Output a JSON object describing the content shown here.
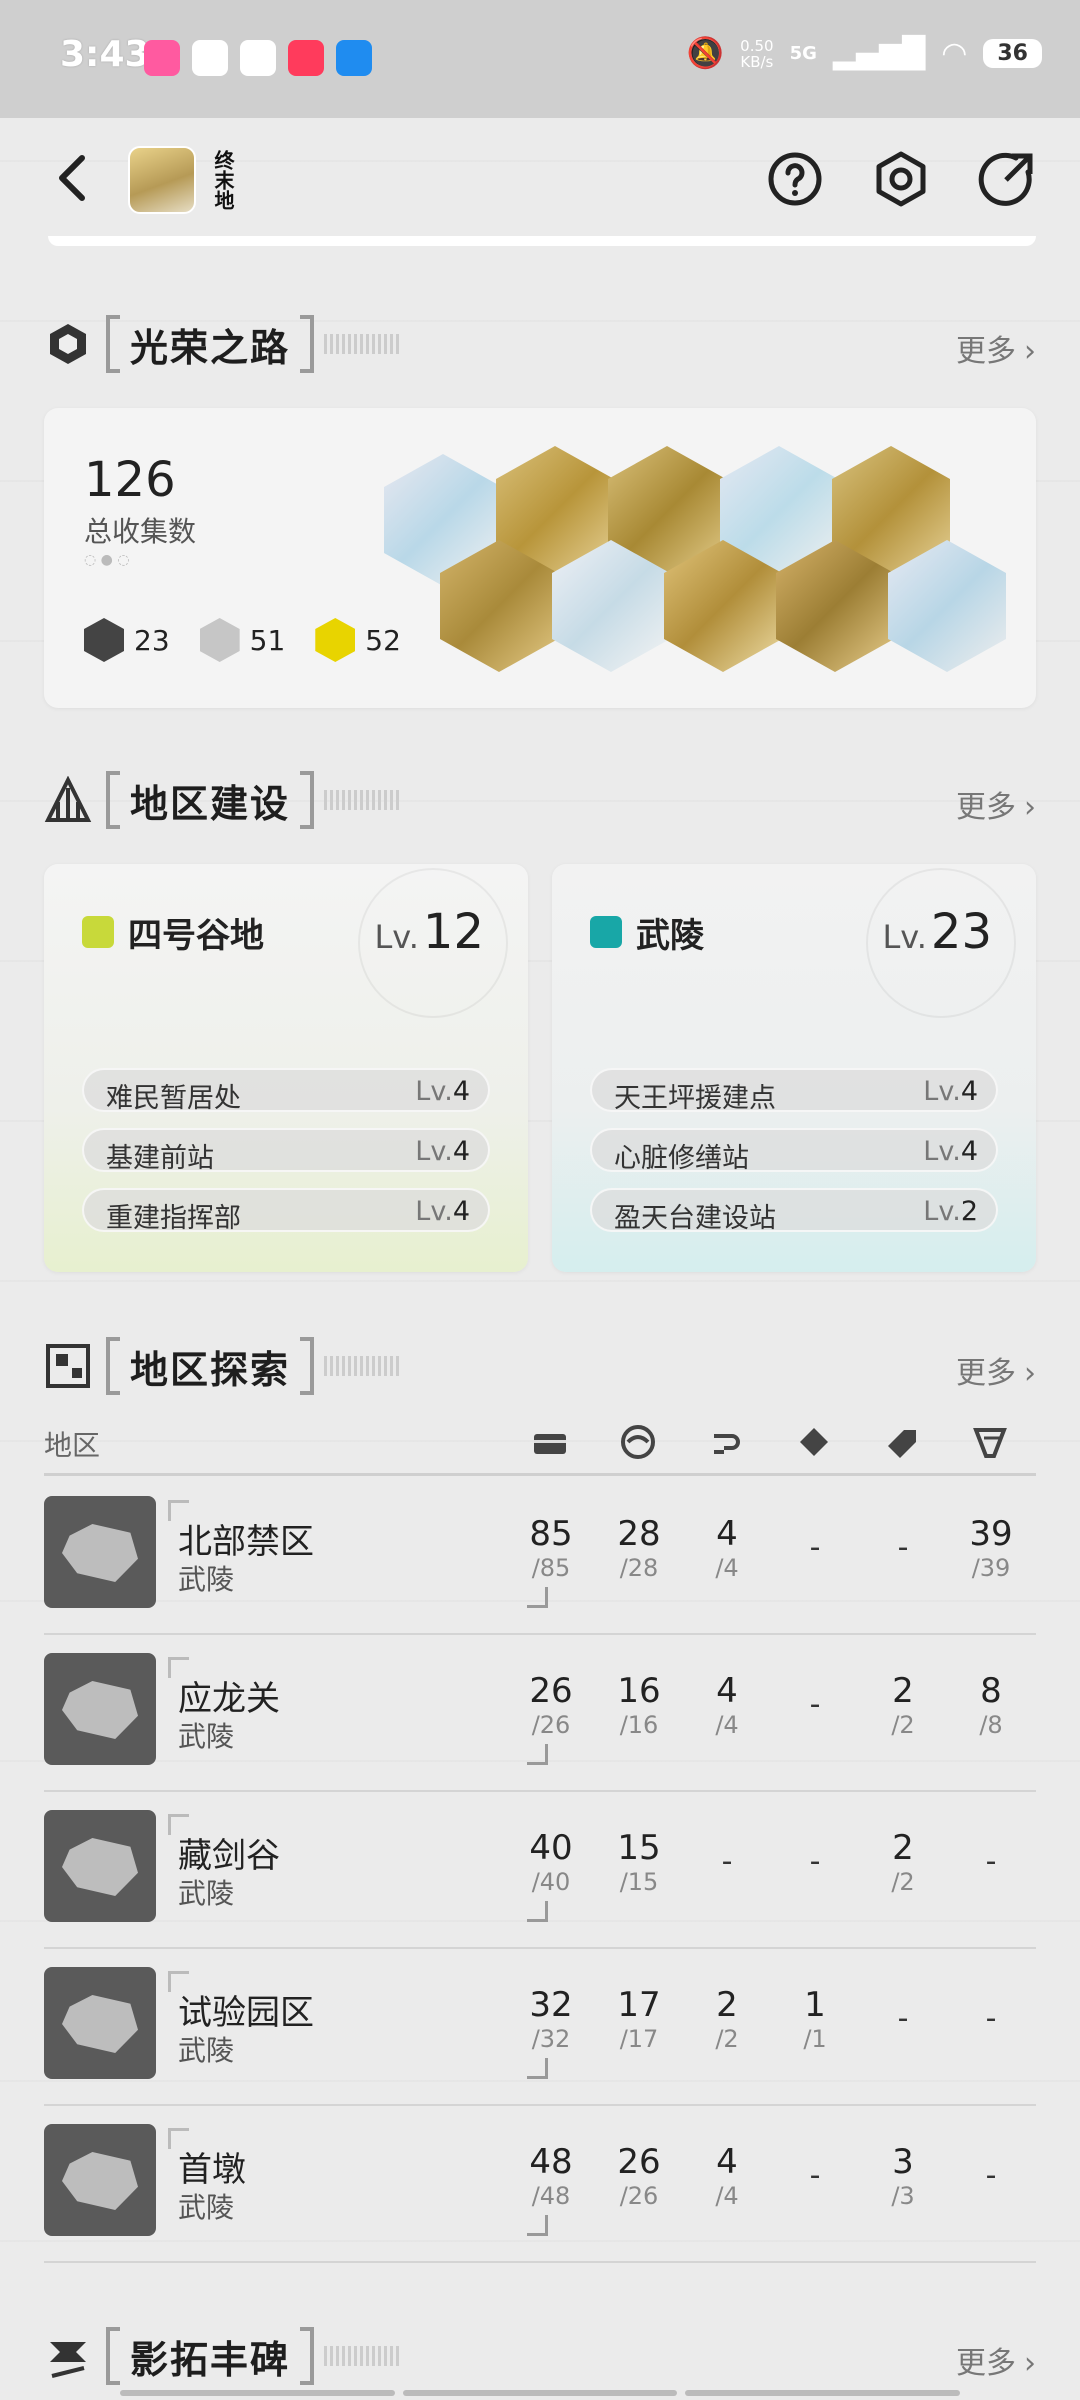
{
  "status": {
    "time": "3:43",
    "net_speed": "0.50",
    "net_unit": "KB/s",
    "network": "5G",
    "battery": "36"
  },
  "header": {
    "logo_text": "终末地"
  },
  "glory": {
    "title": "光荣之路",
    "more": "更多",
    "total": "126",
    "total_label": "总收集数",
    "counts": [
      {
        "value": "23",
        "color": "#444444"
      },
      {
        "value": "51",
        "color": "#bdbdbd"
      },
      {
        "value": "52",
        "color": "#e8d400"
      }
    ]
  },
  "build": {
    "title": "地区建设",
    "more": "更多",
    "regions": [
      {
        "name": "四号谷地",
        "lv_prefix": "Lv.",
        "level": "12",
        "icon_color": "#c8d93a",
        "sites": [
          {
            "name": "难民暂居处",
            "lv": "4"
          },
          {
            "name": "基建前站",
            "lv": "4"
          },
          {
            "name": "重建指挥部",
            "lv": "4"
          }
        ]
      },
      {
        "name": "武陵",
        "lv_prefix": "Lv.",
        "level": "23",
        "icon_color": "#18a7a7",
        "sites": [
          {
            "name": "天王坪援建点",
            "lv": "4"
          },
          {
            "name": "心脏修缮站",
            "lv": "4"
          },
          {
            "name": "盈天台建设站",
            "lv": "2"
          }
        ]
      }
    ],
    "lv_tag": "Lv."
  },
  "explore": {
    "title": "地区探索",
    "more": "更多",
    "col_region": "地区",
    "rows": [
      {
        "name": "北部禁区",
        "sub": "武陵",
        "cells": [
          [
            "85",
            "/85"
          ],
          [
            "28",
            "/28"
          ],
          [
            "4",
            "/4"
          ],
          [
            "-",
            ""
          ],
          [
            "-",
            ""
          ],
          [
            "39",
            "/39"
          ]
        ]
      },
      {
        "name": "应龙关",
        "sub": "武陵",
        "cells": [
          [
            "26",
            "/26"
          ],
          [
            "16",
            "/16"
          ],
          [
            "4",
            "/4"
          ],
          [
            "-",
            ""
          ],
          [
            "2",
            "/2"
          ],
          [
            "8",
            "/8"
          ]
        ]
      },
      {
        "name": "藏剑谷",
        "sub": "武陵",
        "cells": [
          [
            "40",
            "/40"
          ],
          [
            "15",
            "/15"
          ],
          [
            "-",
            ""
          ],
          [
            "-",
            ""
          ],
          [
            "2",
            "/2"
          ],
          [
            "-",
            ""
          ]
        ]
      },
      {
        "name": "试验园区",
        "sub": "武陵",
        "cells": [
          [
            "32",
            "/32"
          ],
          [
            "17",
            "/17"
          ],
          [
            "2",
            "/2"
          ],
          [
            "1",
            "/1"
          ],
          [
            "-",
            ""
          ],
          [
            "-",
            ""
          ]
        ]
      },
      {
        "name": "首墩",
        "sub": "武陵",
        "cells": [
          [
            "48",
            "/48"
          ],
          [
            "26",
            "/26"
          ],
          [
            "4",
            "/4"
          ],
          [
            "-",
            ""
          ],
          [
            "3",
            "/3"
          ],
          [
            "-",
            ""
          ]
        ]
      }
    ]
  },
  "monument": {
    "title": "影拓丰碑",
    "more": "更多"
  }
}
